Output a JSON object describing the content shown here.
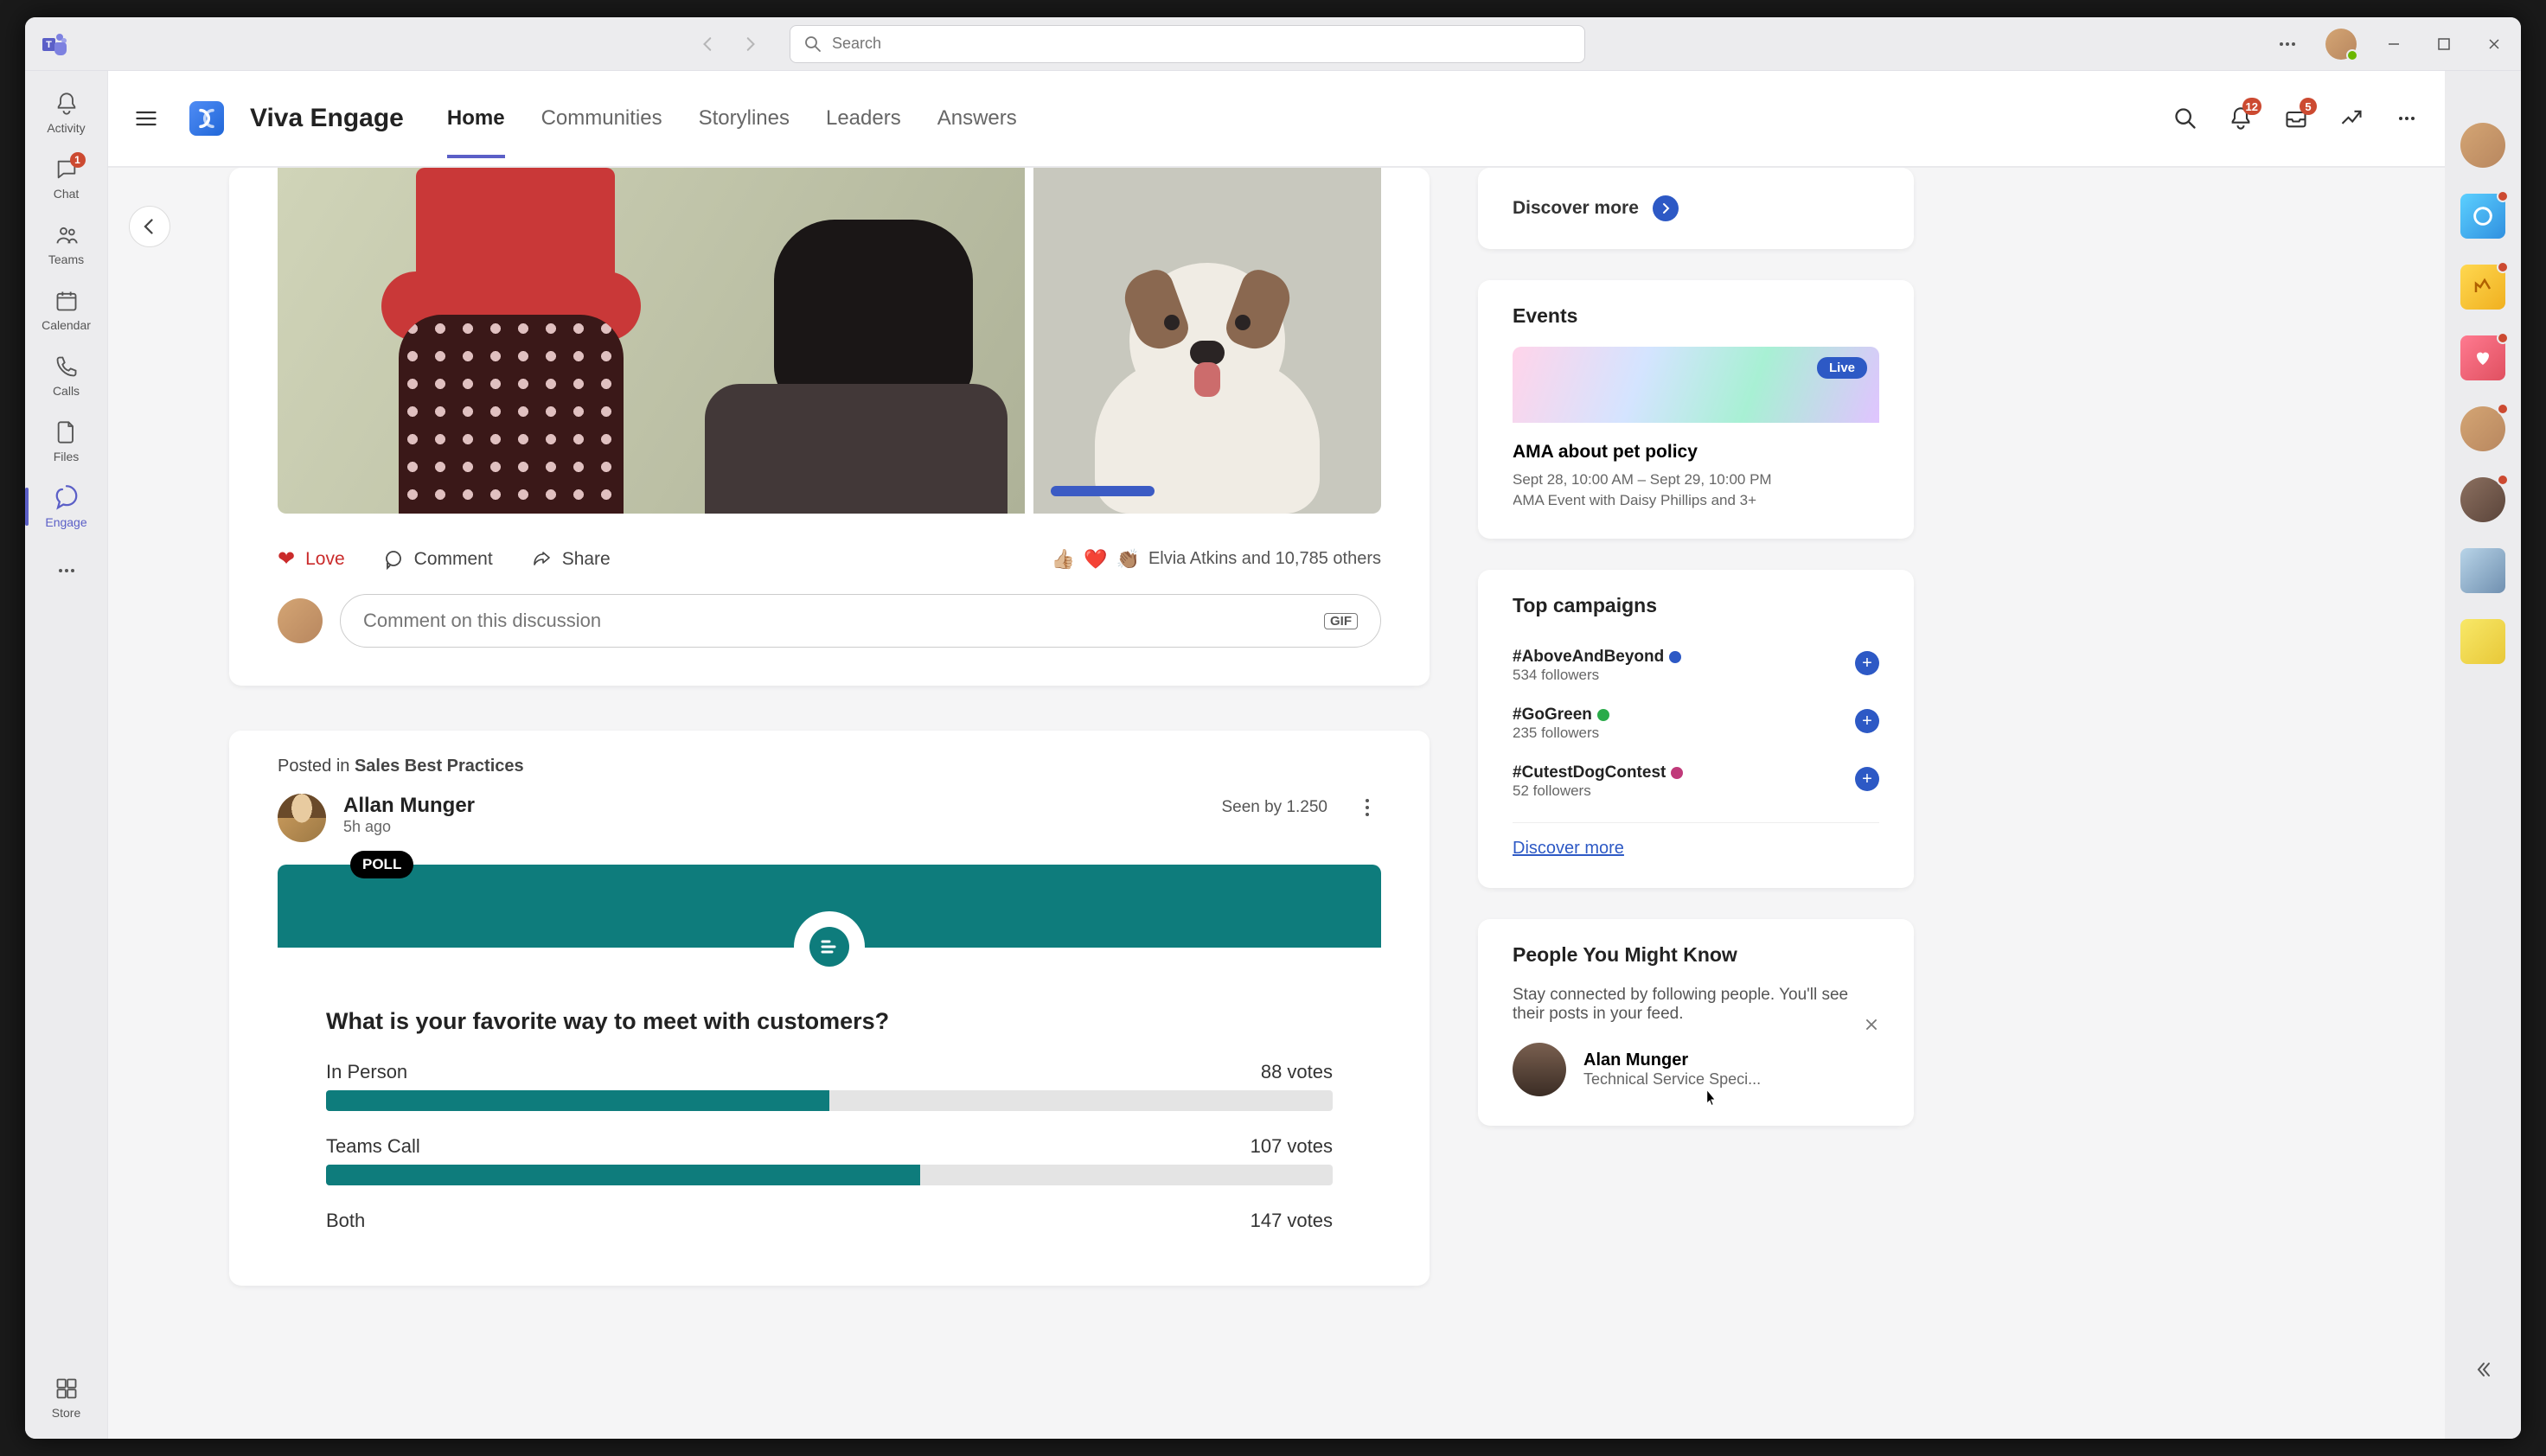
{
  "titlebar": {
    "search_placeholder": "Search"
  },
  "leftrail": {
    "activity": "Activity",
    "chat": "Chat",
    "chat_badge": "1",
    "teams": "Teams",
    "calendar": "Calendar",
    "calls": "Calls",
    "files": "Files",
    "engage": "Engage",
    "store": "Store"
  },
  "app": {
    "brand": "Viva Engage",
    "tabs": {
      "home": "Home",
      "communities": "Communities",
      "storylines": "Storylines",
      "leaders": "Leaders",
      "answers": "Answers"
    },
    "bell_badge": "12",
    "inbox_badge": "5"
  },
  "feed": {
    "post1": {
      "actions": {
        "love": "Love",
        "comment": "Comment",
        "share": "Share"
      },
      "reactions_text": "Elvia Atkins and 10,785 others",
      "comment_placeholder": "Comment on this discussion",
      "gif": "GIF"
    },
    "post2": {
      "posted_in_prefix": "Posted in ",
      "posted_in": "Sales Best Practices",
      "author": "Allan Munger",
      "time": "5h ago",
      "seen": "Seen by 1.250",
      "poll_tag": "POLL",
      "question": "What is your favorite way to meet with customers?",
      "options": [
        {
          "label": "In Person",
          "votes": "88 votes",
          "pct": 50
        },
        {
          "label": "Teams Call",
          "votes": "107 votes",
          "pct": 59
        },
        {
          "label": "Both",
          "votes": "147 votes",
          "pct": 0
        }
      ]
    }
  },
  "sidebar": {
    "discover_more": "Discover more",
    "events": {
      "title": "Events",
      "live": "Live",
      "event_title": "AMA about pet policy",
      "event_meta": "Sept 28, 10:00 AM – Sept 29, 10:00 PM",
      "event_sub": "AMA Event with Daisy Phillips and 3+"
    },
    "campaigns": {
      "title": "Top campaigns",
      "items": [
        {
          "name": "#AboveAndBeyond",
          "followers": "534 followers",
          "color": "#2d59c5"
        },
        {
          "name": "#GoGreen",
          "followers": "235 followers",
          "color": "#2aab4a"
        },
        {
          "name": "#CutestDogContest",
          "followers": "52 followers",
          "color": "#c03a7a"
        }
      ],
      "discover": "Discover more"
    },
    "pymk": {
      "title": "People You Might Know",
      "sub": "Stay connected by following people. You'll see their posts in your feed.",
      "person_name": "Alan Munger",
      "person_sub": "Technical Service Speci..."
    }
  }
}
